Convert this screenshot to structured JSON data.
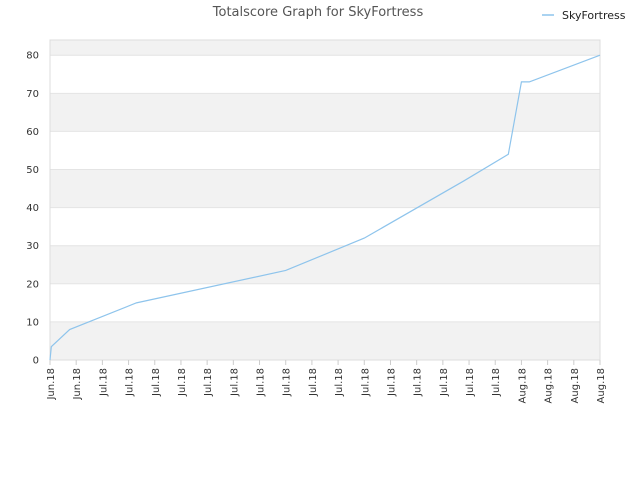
{
  "chart_data": {
    "type": "line",
    "title": "Totalscore Graph for SkyFortress",
    "xlabel": "",
    "ylabel": "",
    "ylim": [
      0,
      84
    ],
    "yticks": [
      0,
      10,
      20,
      30,
      40,
      50,
      60,
      70,
      80
    ],
    "x_tick_labels": [
      "Jun.18",
      "Jun.18",
      "Jul.18",
      "Jul.18",
      "Jul.18",
      "Jul.18",
      "Jul.18",
      "Jul.18",
      "Jul.18",
      "Jul.18",
      "Jul.18",
      "Jul.18",
      "Jul.18",
      "Jul.18",
      "Jul.18",
      "Jul.18",
      "Jul.18",
      "Jul.18",
      "Aug.18",
      "Aug.18",
      "Aug.18",
      "Aug.18"
    ],
    "grid": "horizontal bands",
    "legend": "top-right",
    "colors": {
      "line": "#8ec4ec",
      "band": "#f2f2f2",
      "plot_bg": "#ffffff",
      "axis": "#cccccc"
    },
    "series": [
      {
        "name": "SkyFortress",
        "x_index": [
          0,
          0.05,
          0.75,
          3.3,
          9.0,
          12.0,
          15.8,
          17.5,
          18.0,
          18.3,
          21.0
        ],
        "values": [
          0,
          3.5,
          8,
          15,
          23.5,
          32,
          47,
          54,
          73,
          73,
          80
        ]
      }
    ]
  }
}
